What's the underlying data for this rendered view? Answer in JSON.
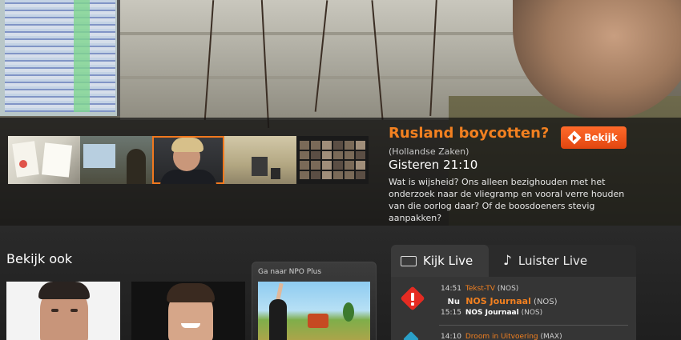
{
  "featured": {
    "title": "Rusland boycotten?",
    "source": "(Hollandse Zaken)",
    "time": "Gisteren 21:10",
    "description": "Wat is wijsheid? Ons alleen bezighouden met het onderzoek naar de vliegramp en vooral verre houden van die oorlog daar? Of de boosdoeners stevig aanpakken?",
    "watch_button": "Bekijk",
    "accent_color": "#f28020",
    "button_color": "#e14610"
  },
  "see_also": {
    "title": "Bekijk ook",
    "npo_plus_label": "Ga naar NPO Plus"
  },
  "live": {
    "tabs": [
      {
        "label": "Kijk Live",
        "icon": "tv-icon",
        "active": true
      },
      {
        "label": "Luister Live",
        "icon": "music-note-icon",
        "active": false
      }
    ],
    "channels": [
      {
        "logo": "nos-exclamation-icon",
        "programs": [
          {
            "time": "14:51",
            "title": "Tekst-TV",
            "channel": "(NOS)"
          },
          {
            "time": "Nu",
            "title": "NOS Journaal",
            "channel": "(NOS)"
          },
          {
            "time": "15:15",
            "title": "NOS Journaal",
            "channel": "(NOS)"
          }
        ]
      },
      {
        "logo": "channel-diamond-icon",
        "programs": [
          {
            "time": "14:10",
            "title": "Droom in Uitvoering",
            "channel": "(MAX)"
          }
        ]
      }
    ]
  }
}
